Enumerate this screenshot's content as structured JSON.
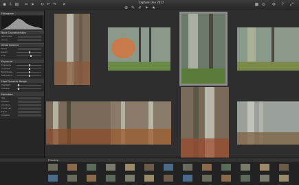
{
  "window": {
    "title": "Capture One 2017"
  },
  "toolbar": {
    "left_icons": [
      "capture-icon",
      "import-icon",
      "library-icon",
      "crop-icon",
      "cursor-icon",
      "rotate-icon",
      "undo-icon",
      "redo-icon",
      "delete-icon"
    ],
    "right_icons": [
      "grid-icon",
      "loupe-icon",
      "settings-icon",
      "help-icon",
      "fullscreen-icon"
    ]
  },
  "sidebar": {
    "histogram_section": "Histogram",
    "sections": [
      "Base Characteristics",
      "White Balance",
      "Exposure",
      "High Dynamic Range",
      "Metadata"
    ],
    "base": {
      "icc_label": "ICC Profile",
      "icc_value": "Nikon D800 Generic",
      "curve_label": "Curve",
      "curve_value": "Film Standard"
    },
    "wb": {
      "mode_label": "Mode",
      "mode_value": "Shot",
      "kelvin_label": "Kelvin",
      "tint_label": "Tint"
    },
    "exposure": {
      "rows": [
        "Exposure",
        "Contrast",
        "Brightness",
        "Saturation"
      ]
    },
    "hdr": {
      "rows": [
        "Highlight",
        "Shadow"
      ]
    },
    "meta": {
      "rows": [
        "ISO",
        "Shutter",
        "Aperture",
        "Focal Len.",
        "Flash",
        "Created"
      ]
    }
  },
  "filmstrip": {
    "header": "Filmstrip",
    "count": 26
  },
  "colors": {
    "accent": "#d8b66a",
    "selection": "#8a8a8a"
  }
}
